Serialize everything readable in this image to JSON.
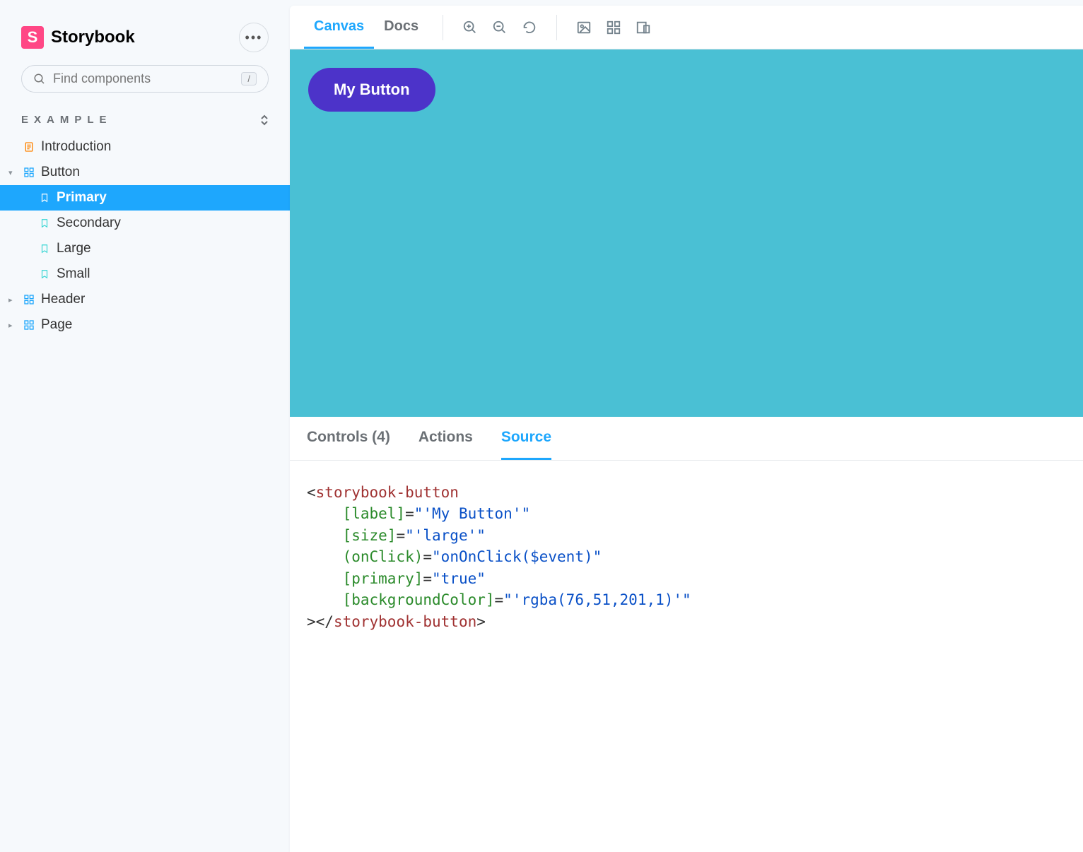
{
  "brand": {
    "logo_letter": "S",
    "title": "Storybook"
  },
  "search": {
    "placeholder": "Find components",
    "shortcut": "/"
  },
  "section_label": "EXAMPLE",
  "tree": {
    "intro": "Introduction",
    "button": "Button",
    "primary": "Primary",
    "secondary": "Secondary",
    "large": "Large",
    "small": "Small",
    "header": "Header",
    "page": "Page"
  },
  "toolbar": {
    "canvas": "Canvas",
    "docs": "Docs"
  },
  "preview": {
    "button_label": "My Button"
  },
  "addons": {
    "controls": "Controls (4)",
    "actions": "Actions",
    "source": "Source"
  },
  "source": {
    "open_brkt": "<",
    "tag": "storybook-button",
    "attr_label": "[label]",
    "val_label": "\"'My Button'\"",
    "attr_size": "[size]",
    "val_size": "\"'large'\"",
    "attr_onclick": "(onClick)",
    "val_onclick": "\"onOnClick($event)\"",
    "attr_primary": "[primary]",
    "val_primary": "\"true\"",
    "attr_bg": "[backgroundColor]",
    "val_bg": "\"'rgba(76,51,201,1)'\"",
    "close_open": "></",
    "close_brkt": ">"
  }
}
